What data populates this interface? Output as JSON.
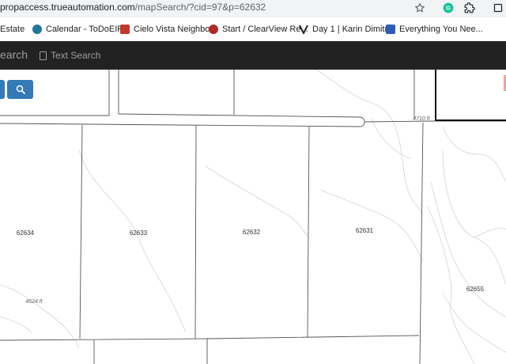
{
  "browser": {
    "url_host": "propaccess.trueautomation.com",
    "url_path": "/mapSearch/?cid=97&p=62632",
    "icons": [
      "star-icon",
      "grammarly-icon",
      "extension-icon",
      "window-icon"
    ]
  },
  "bookmarks": [
    {
      "label": "Estate",
      "color": "#ec6a2a"
    },
    {
      "label": "Calendar - ToDoEIP...",
      "color": "#21759b"
    },
    {
      "label": "Cielo Vista Neighbo...",
      "color": "#c0392b"
    },
    {
      "label": "Start / ClearView Re...",
      "color": "#b02a2a"
    },
    {
      "label": "Day 1 | Karin Dimitr...",
      "color": "#222222"
    },
    {
      "label": "Everything You Nee...",
      "color": "#2c5cb8"
    }
  ],
  "appbar": {
    "brand": "earch",
    "text_search_label": "Text Search"
  },
  "map": {
    "parcels": [
      "62634",
      "62633",
      "62632",
      "62631",
      "62655"
    ],
    "elevations": [
      "4710 ft",
      "4624 ft"
    ]
  }
}
